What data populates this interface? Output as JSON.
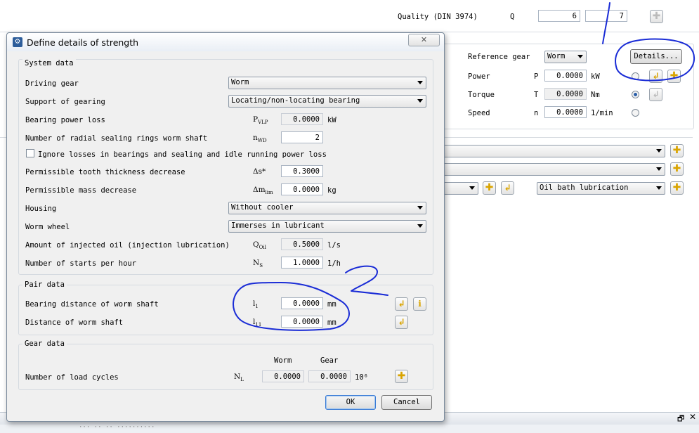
{
  "background": {
    "quality_label": "Quality (DIN 3974)",
    "quality_symbol": "Q",
    "quality_value_1": "6",
    "quality_value_2": "7",
    "reference_gear_label": "Reference gear",
    "reference_gear_value": "Worm",
    "details_button": "Details...",
    "power_label": "Power",
    "power_symbol": "P",
    "power_value": "0.0000",
    "power_unit": "kW",
    "torque_label": "Torque",
    "torque_symbol": "T",
    "torque_value": "0.0000",
    "torque_unit": "Nm",
    "speed_label": "Speed",
    "speed_symbol": "n",
    "speed_value": "0.0000",
    "speed_unit": "1/min",
    "lubrication_value": "Oil bath lubrication",
    "bottom_bar_value": "··· ·· ·· ··········"
  },
  "dialog": {
    "title": "Define details of strength",
    "close_glyph": "✕",
    "system_data": {
      "title": "System data",
      "driving_gear_label": "Driving gear",
      "driving_gear_value": "Worm",
      "support_label": "Support of gearing",
      "support_value": "Locating/non-locating bearing",
      "bearing_loss_label": "Bearing power loss",
      "bearing_loss_symbol": "P",
      "bearing_loss_sub": "VLP",
      "bearing_loss_value": "0.0000",
      "bearing_loss_unit": "kW",
      "sealing_label": "Number of radial sealing rings worm shaft",
      "sealing_symbol": "n",
      "sealing_sub": "WD",
      "sealing_value": "2",
      "ignore_label": "Ignore losses in bearings and sealing and idle running power loss",
      "thickness_label": "Permissible tooth thickness decrease",
      "thickness_symbol": "Δs*",
      "thickness_value": "0.3000",
      "mass_label": "Permissible mass decrease",
      "mass_symbol": "Δm",
      "mass_sub": "lim",
      "mass_value": "0.0000",
      "mass_unit": "kg",
      "housing_label": "Housing",
      "housing_value": "Without cooler",
      "wheel_label": "Worm wheel",
      "wheel_value": "Immerses in lubricant",
      "oil_label": "Amount of injected oil (injection lubrication)",
      "oil_symbol": "Q",
      "oil_sub": "Oil",
      "oil_value": "0.5000",
      "oil_unit": "l/s",
      "starts_label": "Number of starts per hour",
      "starts_symbol": "N",
      "starts_sub": "S",
      "starts_value": "1.0000",
      "starts_unit": "1/h"
    },
    "pair_data": {
      "title": "Pair data",
      "bearing_distance_label": "Bearing distance of worm shaft",
      "bearing_distance_symbol": "l",
      "bearing_distance_sub": "1",
      "bearing_distance_value": "0.0000",
      "bearing_distance_unit": "mm",
      "distance_label": "Distance of worm shaft",
      "distance_symbol": "l",
      "distance_sub": "11",
      "distance_value": "0.0000",
      "distance_unit": "mm"
    },
    "gear_data": {
      "title": "Gear data",
      "col_worm": "Worm",
      "col_gear": "Gear",
      "load_cycles_label": "Number of load cycles",
      "load_cycles_symbol": "N",
      "load_cycles_sub": "L",
      "worm_value": "0.0000",
      "gear_value": "0.0000",
      "unit": "10⁶"
    },
    "ok_button": "OK",
    "cancel_button": "Cancel"
  },
  "colors": {
    "annotation_ink": "#1a2cd6",
    "dialog_bg": "#f0f0f0",
    "accent": "#3a7bd5"
  }
}
